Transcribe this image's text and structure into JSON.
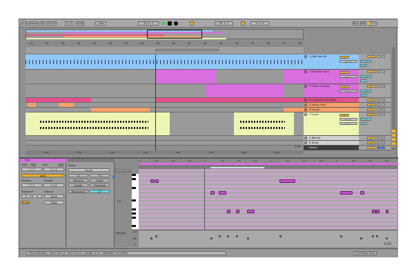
{
  "control_bar": {
    "link": "Link",
    "follow": "Follow",
    "tap": "Tap",
    "tempo": "100.00",
    "signature": "4 / 4",
    "zoom": "100%",
    "quantize": "1 Bar",
    "position": "29.  4.  3",
    "loop_start": "29.  1.  1",
    "loop_length": "4.  0.  0",
    "key": "Key",
    "midi": "MIDI",
    "cpu": "19 %"
  },
  "arrangement": {
    "bar_labels": [
      "21",
      "22",
      "23",
      "24",
      "25",
      "26",
      "27",
      "28",
      "29",
      "30",
      "31",
      "32",
      "33",
      "34",
      "35",
      "36",
      "37",
      "38"
    ],
    "time_labels": [
      "0:50",
      "0:55",
      "1:00",
      "1:05",
      "1:10",
      "1:15",
      "1:20",
      "1:25"
    ],
    "zoom_ratio": "1/4",
    "tracks": [
      {
        "name": "1 808 Core Kit",
        "color": "#8fc8f8",
        "num": "1",
        "routing": "Master",
        "mon": "Auto"
      },
      {
        "name": "2 Dot Bass Rack",
        "color": "#d96ee0",
        "num": "2",
        "routing": "Master",
        "mon": "Auto"
      },
      {
        "name": "3 Three Op Bass",
        "color": "#d96ee0",
        "num": "3",
        "routing": "Master",
        "mon": "Auto"
      },
      {
        "name": "4 Crossover Syn Bass",
        "color": "#e6508e",
        "num": "4"
      },
      {
        "name": "5 Vocals Slice",
        "color": "#f7a06a",
        "num": "5"
      },
      {
        "name": "6 Vocals",
        "color": "#f7a06a",
        "num": "6"
      },
      {
        "name": "7 Synth",
        "color": "#eef5b2",
        "num": "7",
        "routing": "Master",
        "input": "Ext. In",
        "mon": "Auto"
      },
      {
        "name": "A Reverb",
        "color": "#d0d0d0",
        "num": "A"
      },
      {
        "name": "B Delay",
        "color": "#d0d0d0",
        "num": "B"
      },
      {
        "name": "Master",
        "color": "#3c3c3c",
        "num": "0"
      }
    ],
    "mixer_values": {
      "vol": "-inf",
      "pan": "C",
      "master_vol": "0.0"
    }
  },
  "clip_panel": {
    "title": "Clip",
    "start": "Start",
    "end": "End",
    "set": "Set",
    "loop": "Loop",
    "position": "Position",
    "length": "Length",
    "signature": "Signature",
    "groove": "Groove",
    "sig_num": "4",
    "sig_den": "4",
    "groove_val": "None",
    "scale": "Scale",
    "scale_name": "Major",
    "start_val": "1  1  1",
    "end_val": "5  1  1",
    "pos_val": "1  1  1",
    "len_val": "4  0  0"
  },
  "notes_panel": {
    "title": "Notes",
    "range": "A3-E5",
    "half": ":2",
    "double": "*2",
    "reverse": "Reverse",
    "invert": "Invert",
    "legato": "Legato",
    "duplicate": "Duplicate",
    "randomize": "Randomize",
    "velocity": "127"
  },
  "piano_roll": {
    "fold": "Fold",
    "scale": "Scale",
    "c3": "C3",
    "velocity": "Velocity",
    "v127": "127",
    "v64": "64",
    "v1": "1",
    "grid": "1/16",
    "bar_labels": [
      "1",
      "1.2",
      "1.3",
      "1.4",
      "2",
      "2.2",
      "2.3",
      "2.4",
      "3",
      "3.2",
      "3.3",
      "3.4",
      "4",
      "4.2",
      "4.3",
      "4.4"
    ]
  },
  "status_bar": {
    "time_selection": "Time Selection",
    "start": "Start: 30.1.2",
    "end": "End: 30.4.3",
    "length": "Length: 0.3.1",
    "duration": "(Duration: 0:01:950)",
    "selected_track": "2-Dot Bass Rack"
  }
}
